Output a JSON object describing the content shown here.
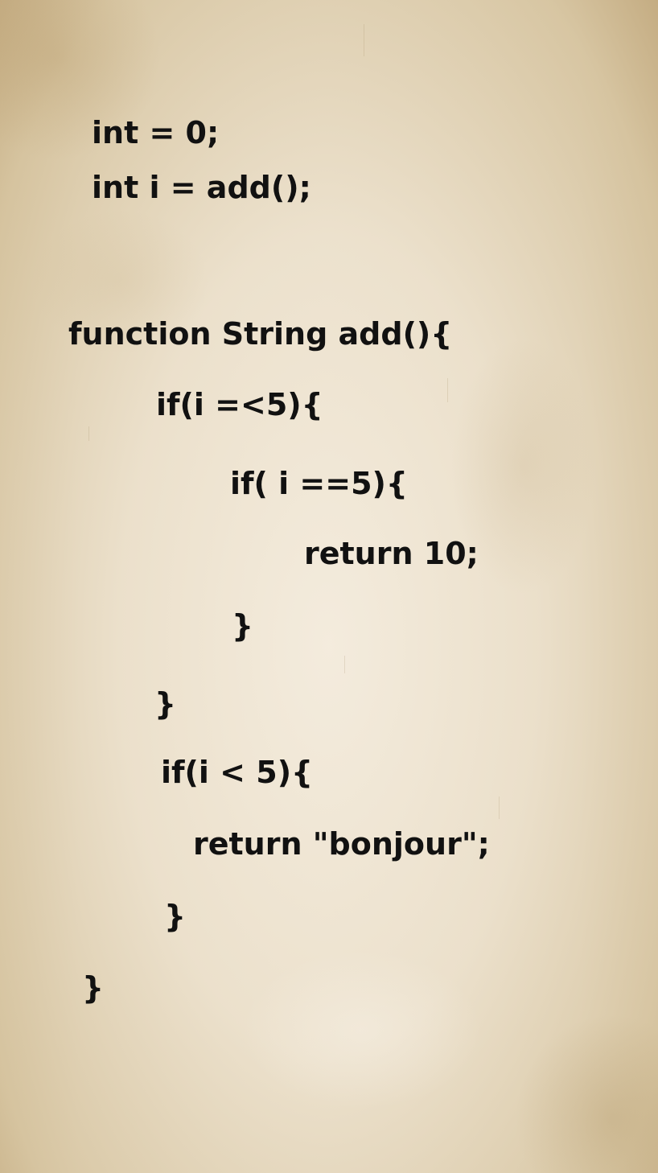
{
  "code_lines": [
    "int = 0;",
    "int i = add();",
    "function String add(){",
    "if(i =<5){",
    "if( i ==5){",
    "return 10;",
    "}",
    "}",
    "if(i < 5){",
    "return \"bonjour\";",
    "}",
    "}"
  ],
  "colors": {
    "paper": "#e8dcc4",
    "text": "#111111"
  }
}
